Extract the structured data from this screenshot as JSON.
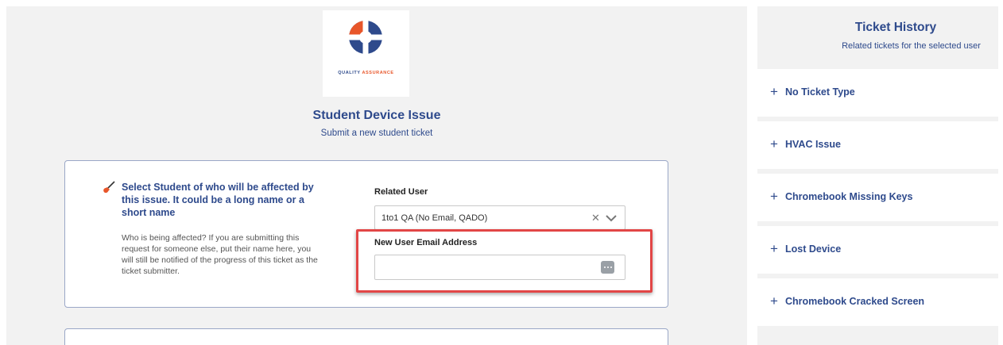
{
  "logo": {
    "text_main": "QUALITY",
    "text_accent": "ASSURANCE",
    "icon": "quality-assurance-logo",
    "colors": {
      "blue": "#2e4a8c",
      "orange": "#e8562a"
    }
  },
  "form": {
    "title": "Student Device Issue",
    "subtitle": "Submit a new student ticket",
    "question": {
      "icon": "guitar-icon",
      "title": "Select Student of who will be affected by this issue. It could be a long name or a short name",
      "description": "Who is being affected? If you are submitting this request for someone else, put their name here, you will still be notified of the progress of this ticket as the ticket submitter."
    },
    "related_user": {
      "label": "Related User",
      "value": "1to1 QA (No Email, QADO)",
      "clear_symbol": "✕"
    },
    "new_email": {
      "label": "New User Email Address",
      "value": "",
      "placeholder": ""
    }
  },
  "history": {
    "title": "Ticket History",
    "subtitle": "Related tickets for the selected user",
    "items": [
      {
        "label": "No Ticket Type"
      },
      {
        "label": "HVAC Issue"
      },
      {
        "label": "Chromebook Missing Keys"
      },
      {
        "label": "Lost Device"
      },
      {
        "label": "Chromebook Cracked Screen"
      }
    ],
    "expand_symbol": "+"
  },
  "colors": {
    "accent": "#2e4a8c",
    "highlight": "#e24646",
    "panel_bg": "#f2f2f2"
  }
}
